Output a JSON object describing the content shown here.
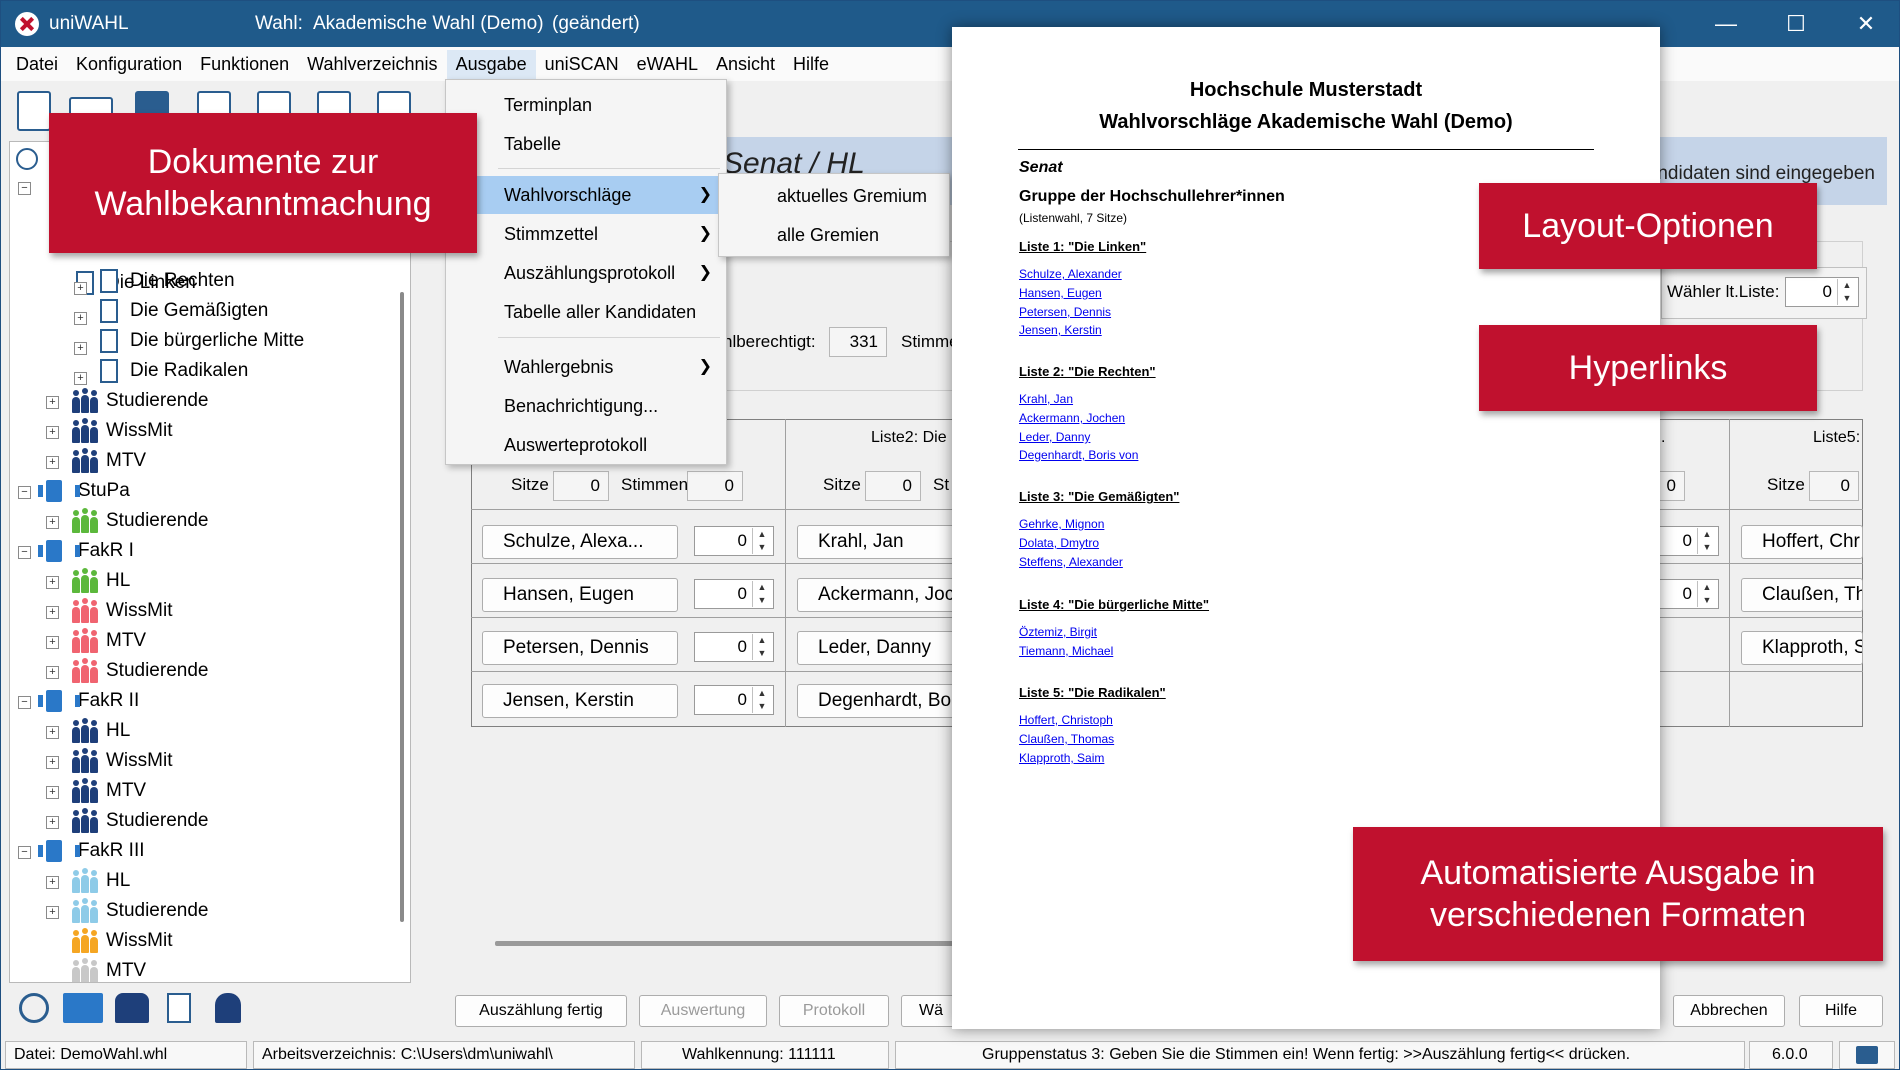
{
  "window": {
    "app_name": "uniWAHL",
    "title_label": "Wahl:",
    "title_name": "Akademische Wahl (Demo)",
    "title_changed": "(geändert)"
  },
  "menubar": [
    "Datei",
    "Konfiguration",
    "Funktionen",
    "Wahlverzeichnis",
    "Ausgabe",
    "uniSCAN",
    "eWAHL",
    "Ansicht",
    "Hilfe"
  ],
  "dropdown": {
    "items": [
      {
        "label": "Terminplan",
        "submenu": false
      },
      {
        "label": "Tabelle",
        "submenu": false
      },
      {
        "label": "Wahlvorschläge",
        "submenu": true
      },
      {
        "label": "Stimmzettel",
        "submenu": true
      },
      {
        "label": "Auszählungsprotokoll",
        "submenu": true
      },
      {
        "label": "Tabelle aller Kandidaten",
        "submenu": false
      },
      {
        "label": "Wahlergebnis",
        "submenu": true
      },
      {
        "label": "Benachrichtigung...",
        "submenu": false
      },
      {
        "label": "Auswerteprotokoll",
        "submenu": false
      }
    ],
    "submenu": [
      "aktuelles Gremium",
      "alle Gremien"
    ]
  },
  "tree": {
    "items": [
      "Die Linken",
      "Die Rechten",
      "Die Gemäßigten",
      "Die bürgerliche Mitte",
      "Die Radikalen",
      "Studierende",
      "WissMit",
      "MTV",
      "StuPa",
      "Studierende",
      "FakR I",
      "HL",
      "WissMit",
      "MTV",
      "Studierende",
      "FakR II",
      "HL",
      "WissMit",
      "MTV",
      "Studierende",
      "FakR III",
      "HL",
      "Studierende",
      "WissMit",
      "MTV"
    ]
  },
  "colors": {
    "navy": "#1e3f7a",
    "green": "#5cb83c",
    "red": "#f06470",
    "lightblue": "#8ecbe8",
    "orange": "#f5a623",
    "grey": "#c8c8c8",
    "callout": "#c0112e"
  },
  "main": {
    "header_title": "Senat / HL",
    "header_status": "ndidaten sind eingegeben",
    "wahlberechtigt_label": "hlberechtigt:",
    "wahlberechtigt_value": "331",
    "stimmen_label": "Stimme",
    "waehler_label": "Wähler lt.Liste:",
    "waehler_value": "0",
    "sitze_label": "Sitze",
    "stimmen_col_label": "Stimmen",
    "sitze_value": "0",
    "stimmen_value": "0",
    "col2_header": "Liste2: Die",
    "col5_header": "Liste5:",
    "col1_candidates": [
      "Schulze, Alexa...",
      "Hansen, Eugen",
      "Petersen, Dennis",
      "Jensen, Kerstin"
    ],
    "col2_candidates": [
      "Krahl, Jan",
      "Ackermann, Joc",
      "Leder, Danny",
      "Degenhardt, Bo"
    ],
    "col5_candidates": [
      "Hoffert, Chr",
      "Claußen, Th",
      "Klapproth, S"
    ],
    "spin_value": "0",
    "st_label": "St",
    "dot_label": "."
  },
  "buttons": {
    "auszaehlung": "Auszählung fertig",
    "auswertung": "Auswertung",
    "protokoll": "Protokoll",
    "wae": "Wä",
    "abbrechen": "Abbrechen",
    "hilfe": "Hilfe"
  },
  "statusbar": {
    "datei": "Datei: DemoWahl.whl",
    "verzeichnis": "Arbeitsverzeichnis: C:\\Users\\dm\\uniwahl\\",
    "kennung": "Wahlkennung: 111111",
    "gruppenstatus": "Gruppenstatus 3: Geben Sie die Stimmen ein! Wenn fertig: >>Auszählung fertig<< drücken.",
    "version": "6.0.0"
  },
  "preview": {
    "title1": "Hochschule Musterstadt",
    "title2": "Wahlvorschläge Akademische Wahl (Demo)",
    "section": "Senat",
    "group": "Gruppe der Hochschullehrer*innen",
    "group_note": "(Listenwahl, 7 Sitze)",
    "lists": [
      {
        "name": "Liste 1: \"Die Linken\"",
        "candidates": [
          "Schulze, Alexander",
          "Hansen, Eugen",
          "Petersen, Dennis",
          "Jensen, Kerstin"
        ]
      },
      {
        "name": "Liste 2: \"Die Rechten\"",
        "candidates": [
          "Krahl, Jan",
          "Ackermann, Jochen",
          "Leder, Danny",
          "Degenhardt, Boris von"
        ]
      },
      {
        "name": "Liste 3: \"Die Gemäßigten\"",
        "candidates": [
          "Gehrke, Mignon",
          "Dolata, Dmytro",
          "Steffens, Alexander"
        ]
      },
      {
        "name": "Liste 4: \"Die bürgerliche Mitte\"",
        "candidates": [
          "Öztemiz, Birgit",
          "Tiemann, Michael"
        ]
      },
      {
        "name": "Liste 5: \"Die Radikalen\"",
        "candidates": [
          "Hoffert, Christoph",
          "Claußen, Thomas",
          "Klapproth, Saim"
        ]
      }
    ]
  },
  "callouts": {
    "dokumente_line1": "Dokumente zur",
    "dokumente_line2": "Wahlbekanntmachung",
    "layout": "Layout-Optionen",
    "hyperlinks": "Hyperlinks",
    "formate_line1": "Automatisierte Ausgabe in",
    "formate_line2": "verschiedenen Formaten"
  }
}
